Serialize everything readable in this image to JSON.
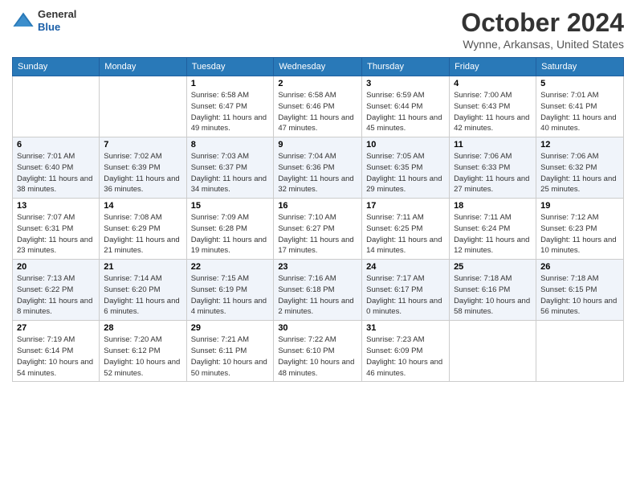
{
  "header": {
    "logo": {
      "general": "General",
      "blue": "Blue"
    },
    "title": "October 2024",
    "location": "Wynne, Arkansas, United States"
  },
  "days_of_week": [
    "Sunday",
    "Monday",
    "Tuesday",
    "Wednesday",
    "Thursday",
    "Friday",
    "Saturday"
  ],
  "weeks": [
    [
      {
        "num": "",
        "info": ""
      },
      {
        "num": "",
        "info": ""
      },
      {
        "num": "1",
        "info": "Sunrise: 6:58 AM\nSunset: 6:47 PM\nDaylight: 11 hours and 49 minutes."
      },
      {
        "num": "2",
        "info": "Sunrise: 6:58 AM\nSunset: 6:46 PM\nDaylight: 11 hours and 47 minutes."
      },
      {
        "num": "3",
        "info": "Sunrise: 6:59 AM\nSunset: 6:44 PM\nDaylight: 11 hours and 45 minutes."
      },
      {
        "num": "4",
        "info": "Sunrise: 7:00 AM\nSunset: 6:43 PM\nDaylight: 11 hours and 42 minutes."
      },
      {
        "num": "5",
        "info": "Sunrise: 7:01 AM\nSunset: 6:41 PM\nDaylight: 11 hours and 40 minutes."
      }
    ],
    [
      {
        "num": "6",
        "info": "Sunrise: 7:01 AM\nSunset: 6:40 PM\nDaylight: 11 hours and 38 minutes."
      },
      {
        "num": "7",
        "info": "Sunrise: 7:02 AM\nSunset: 6:39 PM\nDaylight: 11 hours and 36 minutes."
      },
      {
        "num": "8",
        "info": "Sunrise: 7:03 AM\nSunset: 6:37 PM\nDaylight: 11 hours and 34 minutes."
      },
      {
        "num": "9",
        "info": "Sunrise: 7:04 AM\nSunset: 6:36 PM\nDaylight: 11 hours and 32 minutes."
      },
      {
        "num": "10",
        "info": "Sunrise: 7:05 AM\nSunset: 6:35 PM\nDaylight: 11 hours and 29 minutes."
      },
      {
        "num": "11",
        "info": "Sunrise: 7:06 AM\nSunset: 6:33 PM\nDaylight: 11 hours and 27 minutes."
      },
      {
        "num": "12",
        "info": "Sunrise: 7:06 AM\nSunset: 6:32 PM\nDaylight: 11 hours and 25 minutes."
      }
    ],
    [
      {
        "num": "13",
        "info": "Sunrise: 7:07 AM\nSunset: 6:31 PM\nDaylight: 11 hours and 23 minutes."
      },
      {
        "num": "14",
        "info": "Sunrise: 7:08 AM\nSunset: 6:29 PM\nDaylight: 11 hours and 21 minutes."
      },
      {
        "num": "15",
        "info": "Sunrise: 7:09 AM\nSunset: 6:28 PM\nDaylight: 11 hours and 19 minutes."
      },
      {
        "num": "16",
        "info": "Sunrise: 7:10 AM\nSunset: 6:27 PM\nDaylight: 11 hours and 17 minutes."
      },
      {
        "num": "17",
        "info": "Sunrise: 7:11 AM\nSunset: 6:25 PM\nDaylight: 11 hours and 14 minutes."
      },
      {
        "num": "18",
        "info": "Sunrise: 7:11 AM\nSunset: 6:24 PM\nDaylight: 11 hours and 12 minutes."
      },
      {
        "num": "19",
        "info": "Sunrise: 7:12 AM\nSunset: 6:23 PM\nDaylight: 11 hours and 10 minutes."
      }
    ],
    [
      {
        "num": "20",
        "info": "Sunrise: 7:13 AM\nSunset: 6:22 PM\nDaylight: 11 hours and 8 minutes."
      },
      {
        "num": "21",
        "info": "Sunrise: 7:14 AM\nSunset: 6:20 PM\nDaylight: 11 hours and 6 minutes."
      },
      {
        "num": "22",
        "info": "Sunrise: 7:15 AM\nSunset: 6:19 PM\nDaylight: 11 hours and 4 minutes."
      },
      {
        "num": "23",
        "info": "Sunrise: 7:16 AM\nSunset: 6:18 PM\nDaylight: 11 hours and 2 minutes."
      },
      {
        "num": "24",
        "info": "Sunrise: 7:17 AM\nSunset: 6:17 PM\nDaylight: 11 hours and 0 minutes."
      },
      {
        "num": "25",
        "info": "Sunrise: 7:18 AM\nSunset: 6:16 PM\nDaylight: 10 hours and 58 minutes."
      },
      {
        "num": "26",
        "info": "Sunrise: 7:18 AM\nSunset: 6:15 PM\nDaylight: 10 hours and 56 minutes."
      }
    ],
    [
      {
        "num": "27",
        "info": "Sunrise: 7:19 AM\nSunset: 6:14 PM\nDaylight: 10 hours and 54 minutes."
      },
      {
        "num": "28",
        "info": "Sunrise: 7:20 AM\nSunset: 6:12 PM\nDaylight: 10 hours and 52 minutes."
      },
      {
        "num": "29",
        "info": "Sunrise: 7:21 AM\nSunset: 6:11 PM\nDaylight: 10 hours and 50 minutes."
      },
      {
        "num": "30",
        "info": "Sunrise: 7:22 AM\nSunset: 6:10 PM\nDaylight: 10 hours and 48 minutes."
      },
      {
        "num": "31",
        "info": "Sunrise: 7:23 AM\nSunset: 6:09 PM\nDaylight: 10 hours and 46 minutes."
      },
      {
        "num": "",
        "info": ""
      },
      {
        "num": "",
        "info": ""
      }
    ]
  ]
}
